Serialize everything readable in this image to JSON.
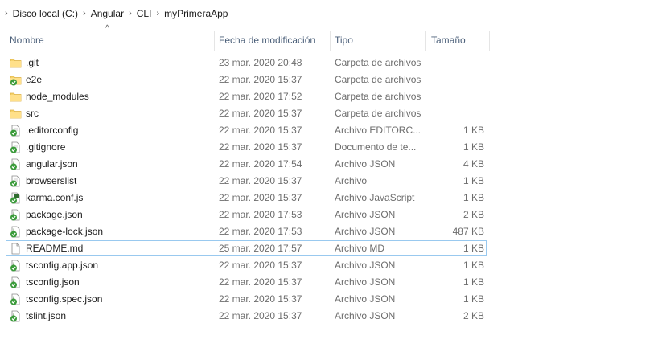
{
  "breadcrumb": [
    "Disco local (C:)",
    "Angular",
    "CLI",
    "myPrimeraApp"
  ],
  "columns": {
    "name": "Nombre",
    "date": "Fecha de modificación",
    "type": "Tipo",
    "size": "Tamaño"
  },
  "sort_indicator": "^",
  "selected_row": 11,
  "files": [
    {
      "name": ".git",
      "date": "23 mar. 2020 20:48",
      "type": "Carpeta de archivos",
      "size": "",
      "icon": "folder-icon"
    },
    {
      "name": "e2e",
      "date": "22 mar. 2020 15:37",
      "type": "Carpeta de archivos",
      "size": "",
      "icon": "folder-synced-icon"
    },
    {
      "name": "node_modules",
      "date": "22 mar. 2020 17:52",
      "type": "Carpeta de archivos",
      "size": "",
      "icon": "folder-icon"
    },
    {
      "name": "src",
      "date": "22 mar. 2020 15:37",
      "type": "Carpeta de archivos",
      "size": "",
      "icon": "folder-icon"
    },
    {
      "name": ".editorconfig",
      "date": "22 mar. 2020 15:37",
      "type": "Archivo EDITORC...",
      "size": "1 KB",
      "icon": "text-file-synced-icon"
    },
    {
      "name": ".gitignore",
      "date": "22 mar. 2020 15:37",
      "type": "Documento de te...",
      "size": "1 KB",
      "icon": "text-file-synced-icon"
    },
    {
      "name": "angular.json",
      "date": "22 mar. 2020 17:54",
      "type": "Archivo JSON",
      "size": "4 KB",
      "icon": "json-file-synced-icon"
    },
    {
      "name": "browserslist",
      "date": "22 mar. 2020 15:37",
      "type": "Archivo",
      "size": "1 KB",
      "icon": "text-file-synced-icon"
    },
    {
      "name": "karma.conf.js",
      "date": "22 mar. 2020 15:37",
      "type": "Archivo JavaScript",
      "size": "1 KB",
      "icon": "js-file-synced-icon"
    },
    {
      "name": "package.json",
      "date": "22 mar. 2020 17:53",
      "type": "Archivo JSON",
      "size": "2 KB",
      "icon": "json-file-synced-icon"
    },
    {
      "name": "package-lock.json",
      "date": "22 mar. 2020 17:53",
      "type": "Archivo JSON",
      "size": "487 KB",
      "icon": "json-file-synced-icon"
    },
    {
      "name": "README.md",
      "date": "25 mar. 2020 17:57",
      "type": "Archivo MD",
      "size": "1 KB",
      "icon": "blank-file-icon"
    },
    {
      "name": "tsconfig.app.json",
      "date": "22 mar. 2020 15:37",
      "type": "Archivo JSON",
      "size": "1 KB",
      "icon": "json-file-synced-icon"
    },
    {
      "name": "tsconfig.json",
      "date": "22 mar. 2020 15:37",
      "type": "Archivo JSON",
      "size": "1 KB",
      "icon": "json-file-synced-icon"
    },
    {
      "name": "tsconfig.spec.json",
      "date": "22 mar. 2020 15:37",
      "type": "Archivo JSON",
      "size": "1 KB",
      "icon": "json-file-synced-icon"
    },
    {
      "name": "tslint.json",
      "date": "22 mar. 2020 15:37",
      "type": "Archivo JSON",
      "size": "2 KB",
      "icon": "json-file-synced-icon"
    }
  ]
}
